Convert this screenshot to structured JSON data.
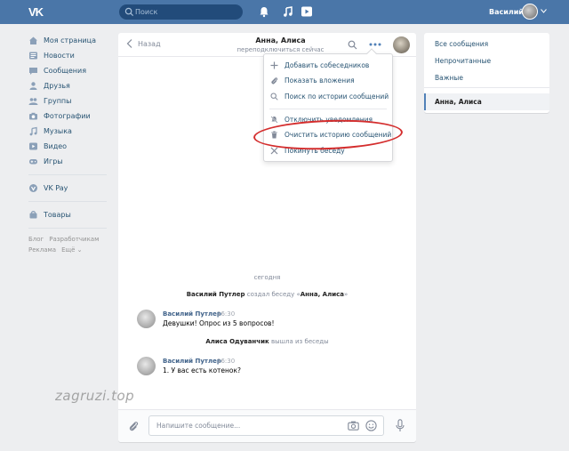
{
  "header": {
    "logo": "VK",
    "search_placeholder": "Поиск",
    "user_name": "Василий"
  },
  "sidebar": {
    "items": [
      {
        "label": "Моя страница",
        "icon": "home-icon"
      },
      {
        "label": "Новости",
        "icon": "news-icon"
      },
      {
        "label": "Сообщения",
        "icon": "messages-icon"
      },
      {
        "label": "Друзья",
        "icon": "friends-icon"
      },
      {
        "label": "Группы",
        "icon": "groups-icon"
      },
      {
        "label": "Фотографии",
        "icon": "camera-icon"
      },
      {
        "label": "Музыка",
        "icon": "music-icon"
      },
      {
        "label": "Видео",
        "icon": "video-icon"
      },
      {
        "label": "Игры",
        "icon": "games-icon"
      }
    ],
    "vkpay": "VK Pay",
    "goods": "Товары",
    "footer": {
      "blog": "Блог",
      "dev": "Разработчикам",
      "ads": "Реклама",
      "more": "Ещё ⌄"
    }
  },
  "chat": {
    "back": "Назад",
    "title": "Анна, Алиса",
    "subtitle": "переподключиться сейчас",
    "day": "сегодня",
    "created": {
      "author": "Василий Путлер",
      "text": " создал беседу «",
      "name": "Анна, Алиса",
      "end": "»"
    },
    "left": {
      "author": "Алиса Одуванчик",
      "text": " вышла из беседы"
    },
    "messages": [
      {
        "author": "Василий Путлер",
        "time": "16:30",
        "text": "Девушки! Опрос из 5 вопросов!"
      },
      {
        "author": "Василий Путлер",
        "time": "16:30",
        "text": "1. У вас есть котенок?"
      }
    ],
    "composer_placeholder": "Напишите сообщение..."
  },
  "menu": {
    "items": [
      {
        "label": "Добавить собеседников",
        "icon": "plus-icon"
      },
      {
        "label": "Показать вложения",
        "icon": "attachment-icon"
      },
      {
        "label": "Поиск по истории сообщений",
        "icon": "search-icon"
      },
      {
        "label": "Отключить уведомления",
        "icon": "mute-icon"
      },
      {
        "label": "Очистить историю сообщений",
        "icon": "trash-icon"
      },
      {
        "label": "Покинуть беседу",
        "icon": "close-icon"
      }
    ]
  },
  "right_panel": {
    "all": "Все сообщения",
    "unread": "Непрочитанные",
    "important": "Важные",
    "active": "Анна, Алиса"
  },
  "watermark": "zagruzi.top",
  "colors": {
    "brand": "#4a76a8",
    "link": "#285473",
    "highlight": "#d42d2d"
  }
}
